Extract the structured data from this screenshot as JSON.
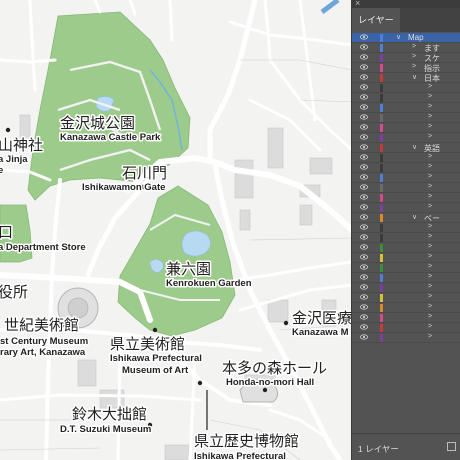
{
  "map": {
    "labels": [
      {
        "id": "castle-ja",
        "text": "金沢城公園"
      },
      {
        "id": "castle-en",
        "text": "Kanazawa Castle Park"
      },
      {
        "id": "gate-ja",
        "text": "石川門"
      },
      {
        "id": "gate-en",
        "text": "Ishikawamon Gate"
      },
      {
        "id": "shrine-ja",
        "text": "山神社"
      },
      {
        "id": "shrine-en",
        "text": "a Jinja"
      },
      {
        "id": "shrine-en2",
        "text": "e"
      },
      {
        "id": "dept-ja",
        "text": "口"
      },
      {
        "id": "dept-en",
        "text": "a Department Store"
      },
      {
        "id": "kenroku-ja",
        "text": "兼六園"
      },
      {
        "id": "kenroku-en",
        "text": "Kenrokuen Garden"
      },
      {
        "id": "hall-ja",
        "text": "役所"
      },
      {
        "id": "museum21-ja",
        "text": "世紀美術館"
      },
      {
        "id": "museum21-en",
        "text": "st Century Museum"
      },
      {
        "id": "museum21-en2",
        "text": "rary Art, Kanazawa"
      },
      {
        "id": "pref-art-ja",
        "text": "県立美術館"
      },
      {
        "id": "pref-art-en",
        "text": "Ishikawa Prefectural"
      },
      {
        "id": "pref-art-en2",
        "text": "Museum of Art"
      },
      {
        "id": "hospital-ja",
        "text": "金沢医療"
      },
      {
        "id": "hospital-en",
        "text": "Kanazawa M"
      },
      {
        "id": "honda-ja",
        "text": "本多の森ホール"
      },
      {
        "id": "honda-en",
        "text": "Honda-no-mori Hall"
      },
      {
        "id": "suzuki-ja",
        "text": "鈴木大拙館"
      },
      {
        "id": "suzuki-en",
        "text": "D.T. Suzuki Museum"
      },
      {
        "id": "history-ja",
        "text": "県立歴史博物館"
      },
      {
        "id": "history-en",
        "text": "Ishikawa Prefectural"
      }
    ]
  },
  "layers_panel": {
    "tab_label": "レイヤー",
    "close_glyph": "×",
    "footer_count": "1 レイヤー",
    "rows": [
      {
        "name": "Map",
        "indent": 0,
        "twist": "∨",
        "swatch": "#4d7fd6",
        "selected": true
      },
      {
        "name": "ます",
        "indent": 1,
        "twist": ">",
        "swatch": "#4d7fd6"
      },
      {
        "name": "スケ",
        "indent": 1,
        "twist": ">",
        "swatch": "#7b3fa0"
      },
      {
        "name": "指示",
        "indent": 1,
        "twist": ">",
        "swatch": "#d44a8a"
      },
      {
        "name": "日本",
        "indent": 1,
        "twist": "∨",
        "swatch": "#c63a3a"
      },
      {
        "name": "",
        "indent": 2,
        "twist": ">",
        "swatch": "#3b3b3b"
      },
      {
        "name": "",
        "indent": 2,
        "twist": ">",
        "swatch": "#3b3b3b"
      },
      {
        "name": "",
        "indent": 2,
        "twist": ">",
        "swatch": "#4d7fd6"
      },
      {
        "name": "",
        "indent": 2,
        "twist": ">",
        "swatch": "#6a6a6a"
      },
      {
        "name": "",
        "indent": 2,
        "twist": ">",
        "swatch": "#d44a8a"
      },
      {
        "name": "",
        "indent": 2,
        "twist": ">",
        "swatch": "#7b3fa0"
      },
      {
        "name": "英語",
        "indent": 1,
        "twist": "∨",
        "swatch": "#c63a3a"
      },
      {
        "name": "",
        "indent": 2,
        "twist": ">",
        "swatch": "#3b3b3b"
      },
      {
        "name": "",
        "indent": 2,
        "twist": ">",
        "swatch": "#3b3b3b"
      },
      {
        "name": "",
        "indent": 2,
        "twist": ">",
        "swatch": "#4d7fd6"
      },
      {
        "name": "",
        "indent": 2,
        "twist": ">",
        "swatch": "#6a6a6a"
      },
      {
        "name": "",
        "indent": 2,
        "twist": ">",
        "swatch": "#d44a8a"
      },
      {
        "name": "",
        "indent": 2,
        "twist": ">",
        "swatch": "#7b3fa0"
      },
      {
        "name": "ベー",
        "indent": 1,
        "twist": "∨",
        "swatch": "#d68a2a"
      },
      {
        "name": "",
        "indent": 2,
        "twist": ">",
        "swatch": "#3b3b3b"
      },
      {
        "name": "",
        "indent": 2,
        "twist": ">",
        "swatch": "#3b3b3b"
      },
      {
        "name": "",
        "indent": 2,
        "twist": ">",
        "swatch": "#3b8f3b"
      },
      {
        "name": "",
        "indent": 2,
        "twist": ">",
        "swatch": "#d6c23a"
      },
      {
        "name": "",
        "indent": 2,
        "twist": ">",
        "swatch": "#3b8f3b"
      },
      {
        "name": "",
        "indent": 2,
        "twist": ">",
        "swatch": "#4d7fd6"
      },
      {
        "name": "",
        "indent": 2,
        "twist": ">",
        "swatch": "#7b3fa0"
      },
      {
        "name": "",
        "indent": 2,
        "twist": ">",
        "swatch": "#d6c23a"
      },
      {
        "name": "",
        "indent": 2,
        "twist": ">",
        "swatch": "#d68a2a"
      },
      {
        "name": "",
        "indent": 2,
        "twist": ">",
        "swatch": "#d44a8a"
      },
      {
        "name": "",
        "indent": 2,
        "twist": ">",
        "swatch": "#c63a3a"
      },
      {
        "name": "",
        "indent": 2,
        "twist": ">",
        "swatch": "#7b3fa0"
      }
    ]
  }
}
